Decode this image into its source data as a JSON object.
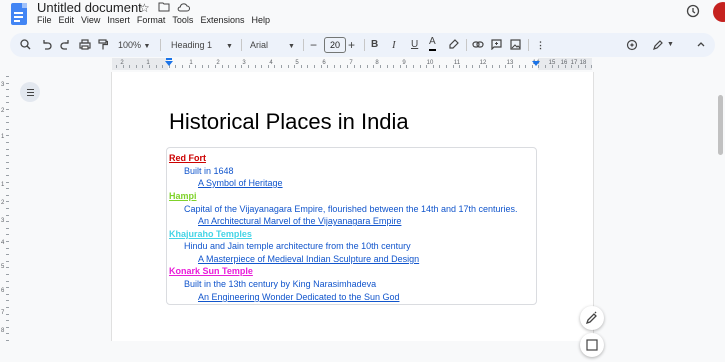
{
  "app": {
    "doc_title": "Untitled document",
    "menu": [
      "File",
      "Edit",
      "View",
      "Insert",
      "Format",
      "Tools",
      "Extensions",
      "Help"
    ]
  },
  "toolbar": {
    "zoom": "100%",
    "style": "Heading 1",
    "font": "Arial",
    "font_size": "20",
    "minus": "−",
    "plus": "+",
    "bold": "B",
    "italic": "I",
    "underline": "U",
    "text_color": "A"
  },
  "ruler": {
    "numbers": [
      "2",
      "1",
      "1",
      "2",
      "3",
      "4",
      "5",
      "6",
      "7",
      "8",
      "9",
      "10",
      "11",
      "12",
      "13",
      "14",
      "15",
      "16",
      "17",
      "18"
    ]
  },
  "vruler": {
    "numbers": [
      "3",
      "2",
      "1",
      "1",
      "2",
      "3",
      "4",
      "5",
      "6",
      "7",
      "8",
      "9"
    ]
  },
  "document": {
    "heading": "Historical Places in India",
    "items": [
      {
        "title": "Red Fort",
        "color": "#cc0000",
        "detail": "Built in 1648",
        "link": "A Symbol of Heritage"
      },
      {
        "title": "Hampi",
        "color": "#7fd22a",
        "detail": "Capital of the Vijayanagara Empire, flourished between the 14th and 17th centuries.",
        "link": "An Architectural Marvel of the Vijayanagara Empire"
      },
      {
        "title": "Khajuraho Temples",
        "color": "#45d4e6",
        "detail": "Hindu and Jain temple architecture from the 10th century",
        "link": "A Masterpiece of Medieval Indian Sculpture and Design"
      },
      {
        "title": "Konark Sun Temple",
        "color": "#e91ed9",
        "detail": "Built in the 13th century by King Narasimhadeva",
        "link": "An Engineering Wonder Dedicated to the Sun God"
      }
    ]
  }
}
